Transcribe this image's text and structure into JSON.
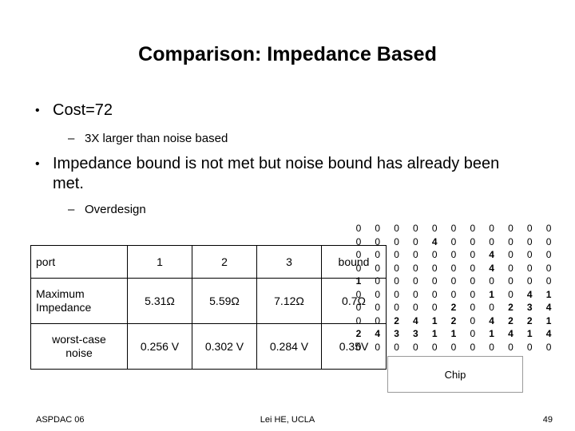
{
  "slide": {
    "title": "Comparison: Impedance Based",
    "bullet_marker": "•",
    "dash_marker": "–"
  },
  "bullets": [
    {
      "level": 1,
      "text": "Cost=72"
    },
    {
      "level": 2,
      "text": "3X larger than noise based"
    },
    {
      "level": 1,
      "text": "Impedance bound is not met but noise bound has already been met."
    },
    {
      "level": 2,
      "text": "Overdesign"
    }
  ],
  "table": {
    "headers": [
      "port",
      "1",
      "2",
      "3",
      "bound"
    ],
    "rows": [
      {
        "label": "Maximum Impedance",
        "label_line1": "Maximum",
        "label_line2": "Impedance",
        "values": [
          "5.31Ω",
          "5.59Ω",
          "7.12Ω",
          "0.7Ω"
        ]
      },
      {
        "label": "worst-case noise",
        "label_line1": "worst-case",
        "label_line2": "noise",
        "values": [
          "0.256 V",
          "0.302 V",
          "0.284 V",
          "0.35V"
        ]
      }
    ]
  },
  "grid": {
    "rows": 10,
    "cols": 11,
    "values": [
      [
        0,
        0,
        0,
        0,
        0,
        0,
        0,
        0,
        0,
        0,
        0
      ],
      [
        0,
        0,
        0,
        0,
        4,
        0,
        0,
        0,
        0,
        0,
        0
      ],
      [
        0,
        0,
        0,
        0,
        0,
        0,
        0,
        4,
        0,
        0,
        0
      ],
      [
        0,
        0,
        0,
        0,
        0,
        0,
        0,
        4,
        0,
        0,
        0
      ],
      [
        1,
        0,
        0,
        0,
        0,
        0,
        0,
        0,
        0,
        0,
        0
      ],
      [
        0,
        0,
        0,
        0,
        0,
        0,
        0,
        1,
        0,
        4,
        1
      ],
      [
        0,
        0,
        0,
        0,
        0,
        2,
        0,
        0,
        2,
        3,
        4
      ],
      [
        0,
        0,
        2,
        4,
        1,
        2,
        0,
        4,
        2,
        2,
        1
      ],
      [
        2,
        4,
        3,
        3,
        1,
        1,
        0,
        1,
        4,
        1,
        4
      ],
      [
        0,
        0,
        0,
        0,
        0,
        0,
        0,
        0,
        0,
        0,
        0
      ]
    ]
  },
  "chip": {
    "label": "Chip"
  },
  "footer": {
    "left": "ASPDAC 06",
    "center": "Lei HE, UCLA",
    "right": "49"
  }
}
